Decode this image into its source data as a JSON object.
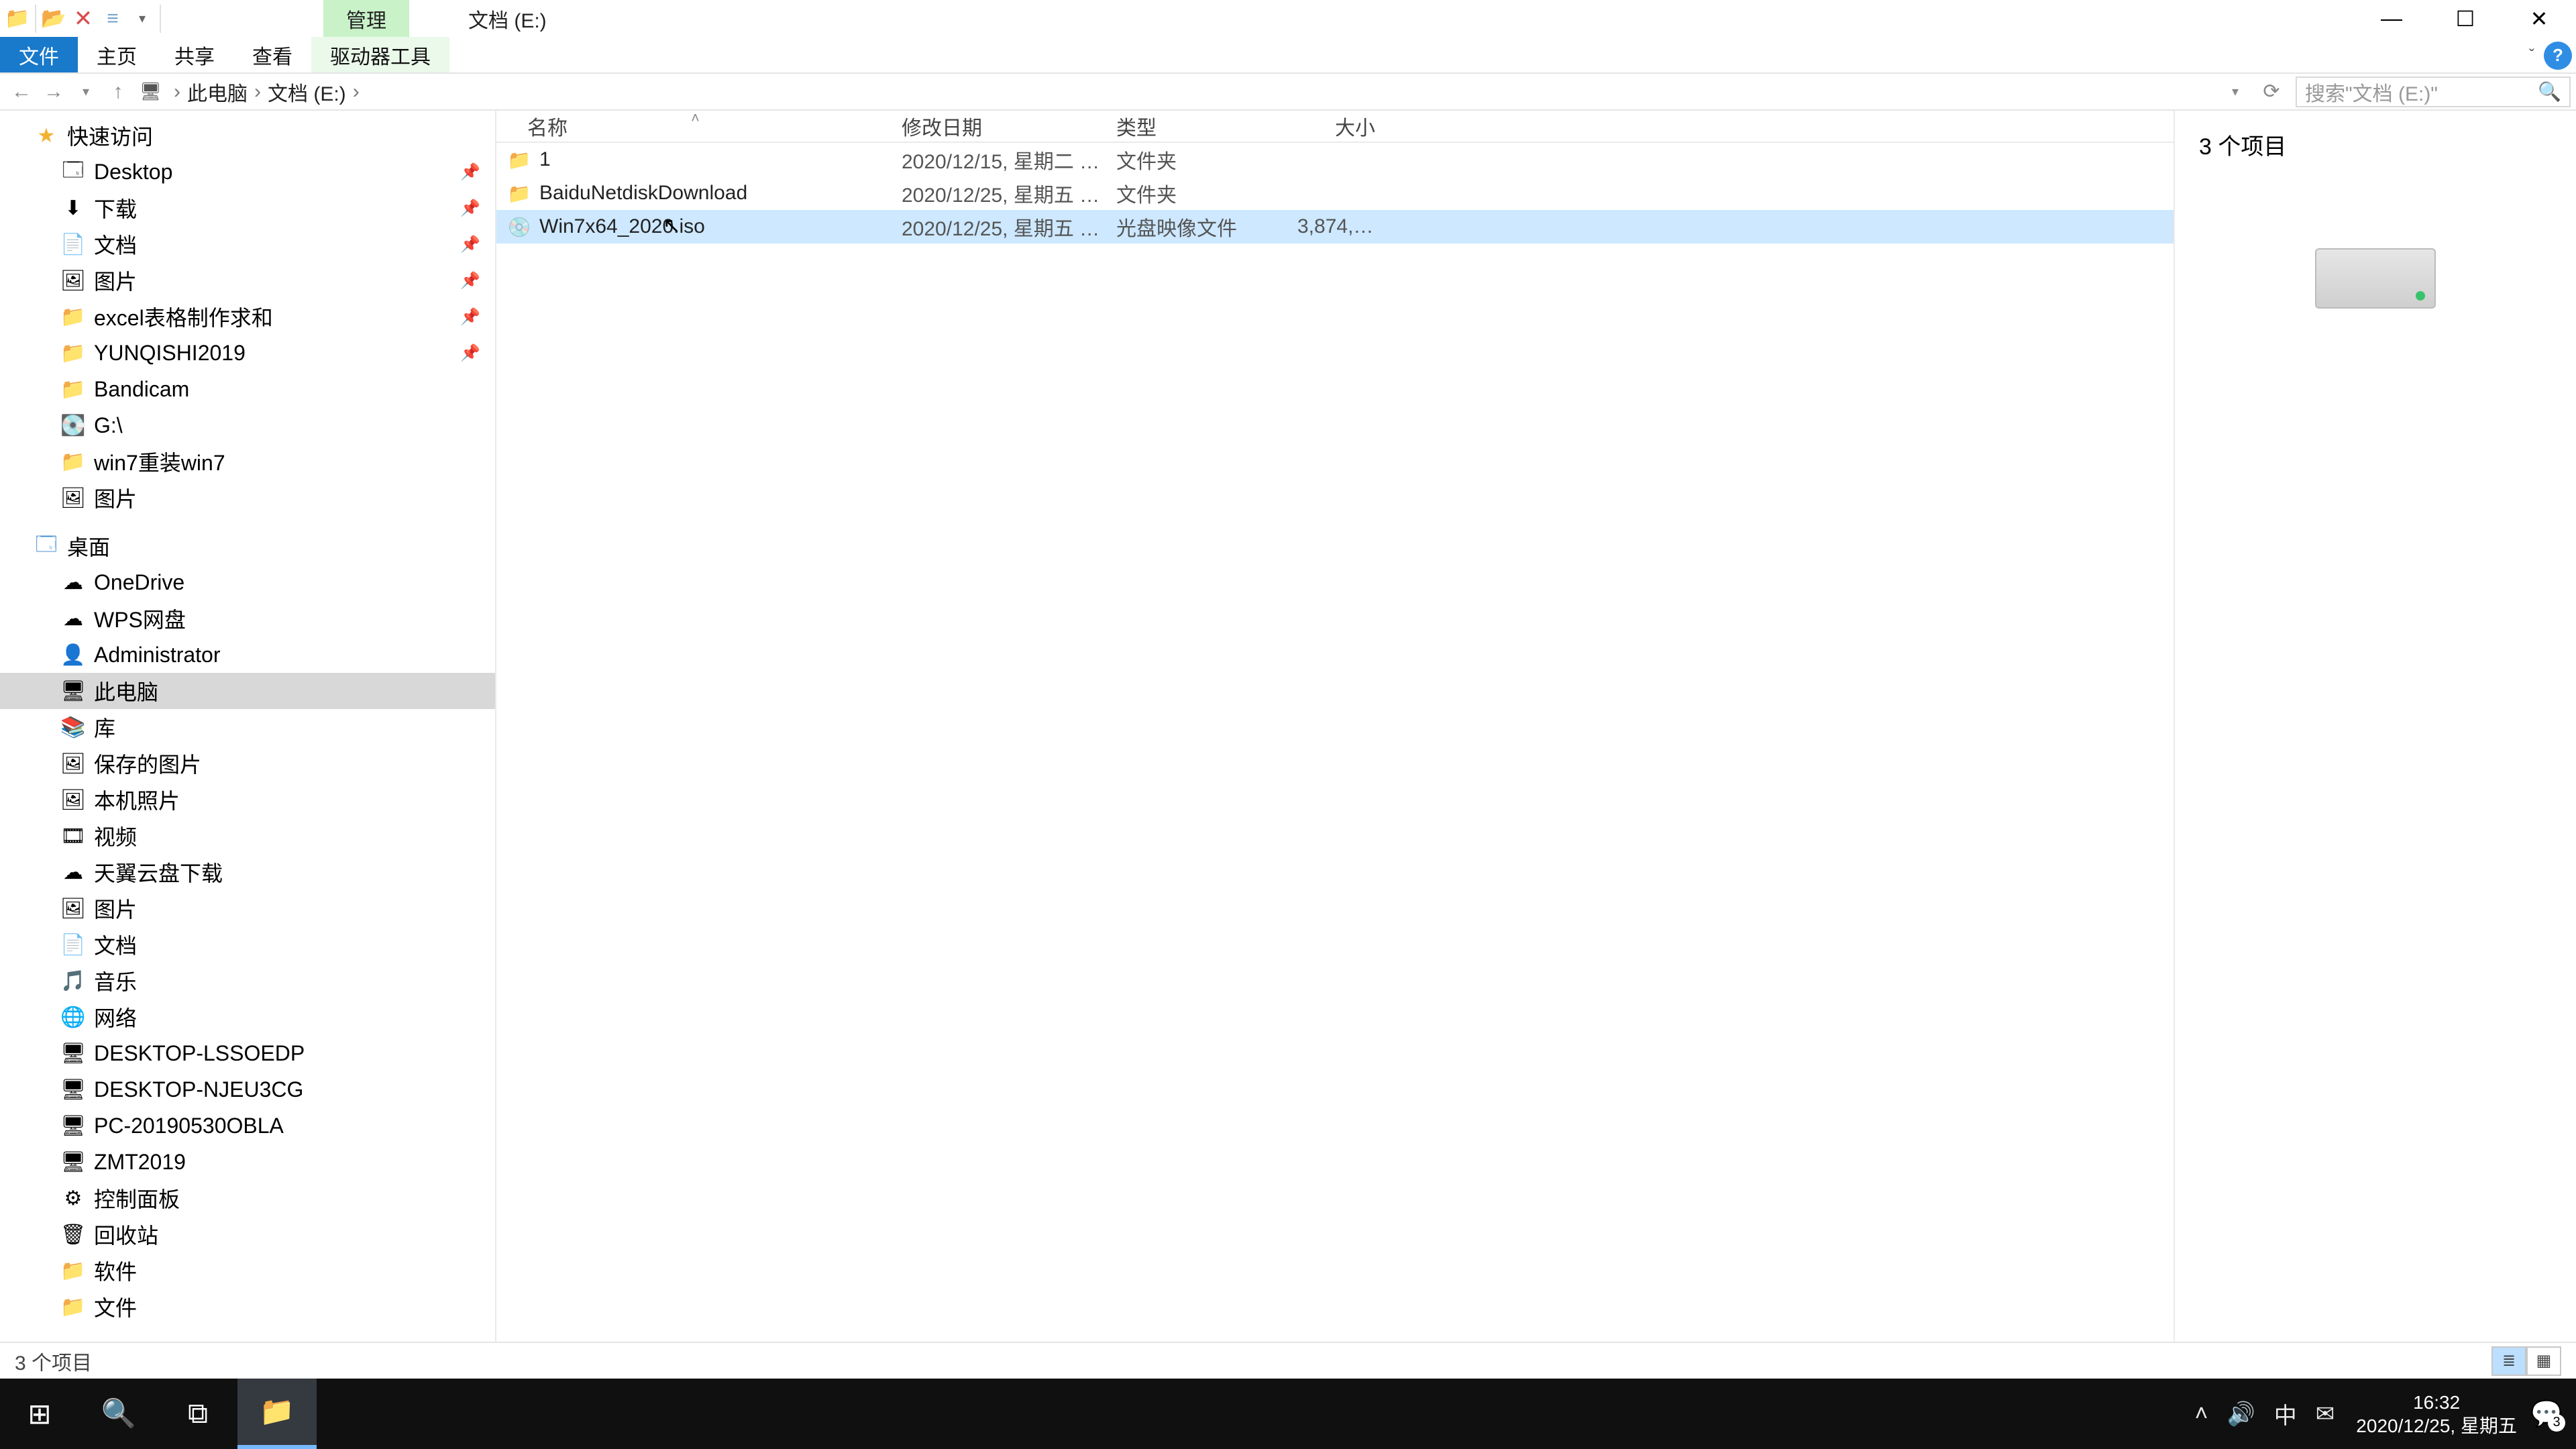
{
  "titlebar": {
    "ctx_tab": "管理",
    "drive_label": "文档 (E:)"
  },
  "ribbon": {
    "file": "文件",
    "home": "主页",
    "share": "共享",
    "view": "查看",
    "drive_tools": "驱动器工具"
  },
  "address": {
    "this_pc": "此电脑",
    "drive": "文档 (E:)"
  },
  "search": {
    "placeholder": "搜索\"文档 (E:)\""
  },
  "nav": {
    "quick_access": "快速访问",
    "qa_items": [
      {
        "label": "Desktop",
        "pinned": true,
        "icon": "🗔"
      },
      {
        "label": "下载",
        "pinned": true,
        "icon": "⬇"
      },
      {
        "label": "文档",
        "pinned": true,
        "icon": "📄"
      },
      {
        "label": "图片",
        "pinned": true,
        "icon": "🖼"
      },
      {
        "label": "excel表格制作求和",
        "pinned": true,
        "icon": "📁"
      },
      {
        "label": "YUNQISHI2019",
        "pinned": true,
        "icon": "📁"
      },
      {
        "label": "Bandicam",
        "pinned": false,
        "icon": "📁"
      },
      {
        "label": "G:\\",
        "pinned": false,
        "icon": "💽"
      },
      {
        "label": "win7重装win7",
        "pinned": false,
        "icon": "📁"
      },
      {
        "label": "图片",
        "pinned": false,
        "icon": "🖼"
      }
    ],
    "desktop": "桌面",
    "desk_items": [
      {
        "label": "OneDrive",
        "icon": "☁"
      },
      {
        "label": "WPS网盘",
        "icon": "☁"
      },
      {
        "label": "Administrator",
        "icon": "👤"
      },
      {
        "label": "此电脑",
        "icon": "🖥",
        "selected": true
      },
      {
        "label": "库",
        "icon": "📚"
      }
    ],
    "lib_items": [
      {
        "label": "保存的图片",
        "icon": "🖼"
      },
      {
        "label": "本机照片",
        "icon": "🖼"
      },
      {
        "label": "视频",
        "icon": "🎞"
      },
      {
        "label": "天翼云盘下载",
        "icon": "☁"
      },
      {
        "label": "图片",
        "icon": "🖼"
      },
      {
        "label": "文档",
        "icon": "📄"
      },
      {
        "label": "音乐",
        "icon": "🎵"
      }
    ],
    "network": "网络",
    "net_items": [
      {
        "label": "DESKTOP-LSSOEDP",
        "icon": "🖥"
      },
      {
        "label": "DESKTOP-NJEU3CG",
        "icon": "🖥"
      },
      {
        "label": "PC-20190530OBLA",
        "icon": "🖥"
      },
      {
        "label": "ZMT2019",
        "icon": "🖥"
      }
    ],
    "extra_items": [
      {
        "label": "控制面板",
        "icon": "⚙"
      },
      {
        "label": "回收站",
        "icon": "🗑"
      },
      {
        "label": "软件",
        "icon": "📁"
      },
      {
        "label": "文件",
        "icon": "📁"
      }
    ]
  },
  "columns": {
    "name": "名称",
    "date": "修改日期",
    "type": "类型",
    "size": "大小"
  },
  "files": [
    {
      "name": "1",
      "date": "2020/12/15, 星期二 1...",
      "type": "文件夹",
      "size": "",
      "kind": "folder"
    },
    {
      "name": "BaiduNetdiskDownload",
      "date": "2020/12/25, 星期五 1...",
      "type": "文件夹",
      "size": "",
      "kind": "folder"
    },
    {
      "name": "Win7x64_2020.iso",
      "date": "2020/12/25, 星期五 1...",
      "type": "光盘映像文件",
      "size": "3,874,126...",
      "kind": "iso",
      "selected": true
    }
  ],
  "preview": {
    "count_text": "3 个项目"
  },
  "status": {
    "text": "3 个项目"
  },
  "taskbar": {
    "time": "16:32",
    "date": "2020/12/25, 星期五",
    "ime": "中",
    "notif_count": "3"
  }
}
